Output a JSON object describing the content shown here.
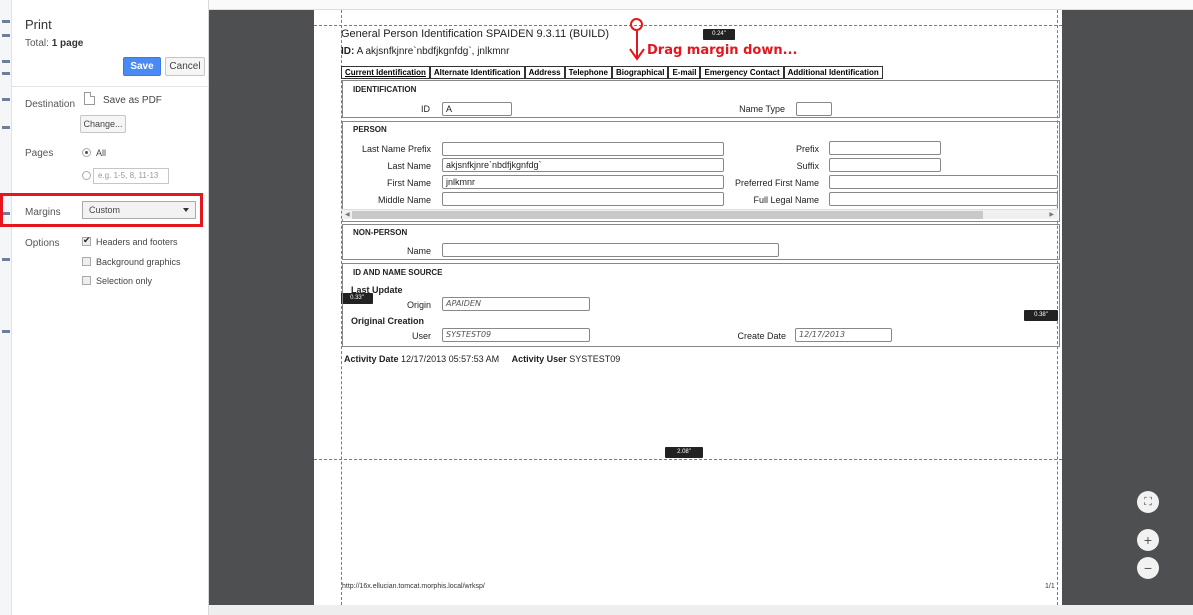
{
  "print_panel": {
    "title": "Print",
    "total_label": "Total:",
    "total_value": "1 page",
    "save_label": "Save",
    "cancel_label": "Cancel",
    "destination_label": "Destination",
    "destination_value": "Save as PDF",
    "change_label": "Change...",
    "pages_label": "Pages",
    "pages_all": "All",
    "pages_placeholder": "e.g. 1-5, 8, 11-13",
    "margins_label": "Margins",
    "margins_value": "Custom",
    "options_label": "Options",
    "opt_headers": "Headers and footers",
    "opt_background": "Background graphics",
    "opt_selection": "Selection only"
  },
  "margin_tags": {
    "top": "0.24\"",
    "left": "0.33\"",
    "right": "0.38\"",
    "bottom": "2.08\""
  },
  "annotation": "Drag margin down...",
  "document": {
    "title": "General Person Identification SPAIDEN 9.3.11 (BUILD)",
    "id_label": "ID:",
    "id_value": "A   akjsnfkjnre`nbdfjkgnfdg`, jnlkmnr",
    "tabs": [
      "Current Identification",
      "Alternate Identification",
      "Address",
      "Telephone",
      "Biographical",
      "E-mail",
      "Emergency Contact",
      "Additional Identification"
    ],
    "identification": {
      "heading": "IDENTIFICATION",
      "id_label": "ID",
      "id_value": "A",
      "name_type_label": "Name Type",
      "name_type_value": ""
    },
    "person": {
      "heading": "PERSON",
      "last_name_prefix_label": "Last Name Prefix",
      "last_name_label": "Last Name",
      "last_name_value": "akjsnfkjnre`nbdfjkgnfdg`",
      "first_name_label": "First Name",
      "first_name_value": "jnlkmnr",
      "middle_name_label": "Middle Name",
      "prefix_label": "Prefix",
      "suffix_label": "Suffix",
      "preferred_first_name_label": "Preferred First Name",
      "full_legal_name_label": "Full Legal Name"
    },
    "non_person": {
      "heading": "NON-PERSON",
      "name_label": "Name"
    },
    "source": {
      "heading": "ID AND NAME SOURCE",
      "last_update": "Last Update",
      "origin_label": "Origin",
      "origin_value": "APAIDEN",
      "original_creation": "Original Creation",
      "user_label": "User",
      "user_value": "SYSTEST09",
      "create_date_label": "Create Date",
      "create_date_value": "12/17/2013"
    },
    "activity_date_label": "Activity Date",
    "activity_date_value": "12/17/2013 05:57:53 AM",
    "activity_user_label": "Activity User",
    "activity_user_value": "SYSTEST09",
    "footer_url": "http://16x.ellucian.tomcat.morphis.local/wrksp/",
    "footer_page": "1/1"
  },
  "zoom_controls": {
    "fit": "⛶",
    "plus": "+",
    "minus": "−"
  }
}
